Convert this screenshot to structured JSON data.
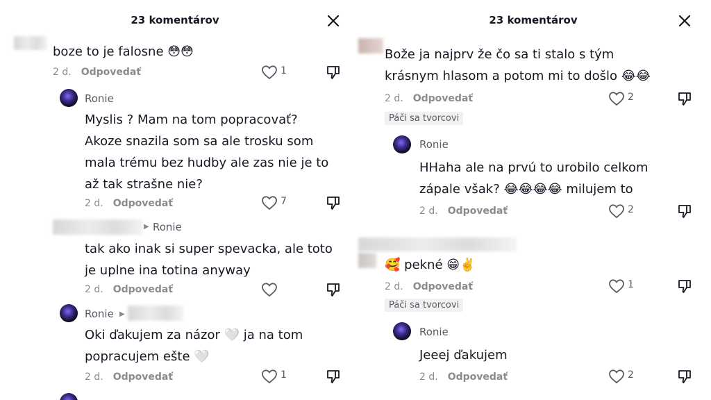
{
  "left": {
    "title": "23 komentárov",
    "comments": [
      {
        "user": "",
        "text": [
          "boze to je falosne 😳😳"
        ],
        "time": "2 d.",
        "reply": "Odpovedať",
        "likes": "1"
      },
      {
        "user": "Ronie",
        "text": [
          "Myslis ? Mam na tom popracovať?",
          "Akoze snazila som sa ale trosku som",
          "mala trému bez hudby ale zas nie je to",
          "až tak strašne nie?"
        ],
        "time": "2 d.",
        "reply": "Odpovedať",
        "likes": "7"
      },
      {
        "user": "",
        "reply_to": "Ronie",
        "text": [
          "tak ako inak si super spevacka, ale toto",
          "je uplne ina totina anyway"
        ],
        "time": "2 d.",
        "reply": "Odpovedať",
        "likes": ""
      },
      {
        "user": "Ronie",
        "text": [
          "Oki ďakujem za názor 🤍 ja na tom",
          "popracujem ešte 🤍"
        ],
        "time": "2 d.",
        "reply": "Odpovedať",
        "likes": "1"
      }
    ]
  },
  "right": {
    "title": "23 komentárov",
    "comments": [
      {
        "user": "",
        "text": [
          "Bože ja najprv že čo sa ti stalo s tým",
          "krásnym hlasom a potom mi to došlo 😂😂"
        ],
        "time": "2 d.",
        "reply": "Odpovedať",
        "likes": "2",
        "badge": "Páči sa tvorcovi"
      },
      {
        "user": "Ronie",
        "text": [
          "HHaha ale na prvú to urobilo celkom",
          "zápale však? 😂😂😂😂 milujem to"
        ],
        "time": "2 d.",
        "reply": "Odpovedať",
        "likes": "2"
      },
      {
        "user": "",
        "text": [
          "🥰 pekné 😁✌️"
        ],
        "time": "2 d.",
        "reply": "Odpovedať",
        "likes": "1",
        "badge": "Páči sa tvorcovi"
      },
      {
        "user": "Ronie",
        "text": [
          "Jeeej ďakujem"
        ],
        "time": "2 d.",
        "reply": "Odpovedať",
        "likes": "2"
      }
    ]
  },
  "icons": {
    "close": "close-icon",
    "like": "heart-outline-icon",
    "dislike": "thumbs-down-icon",
    "avatar": "avatar"
  }
}
